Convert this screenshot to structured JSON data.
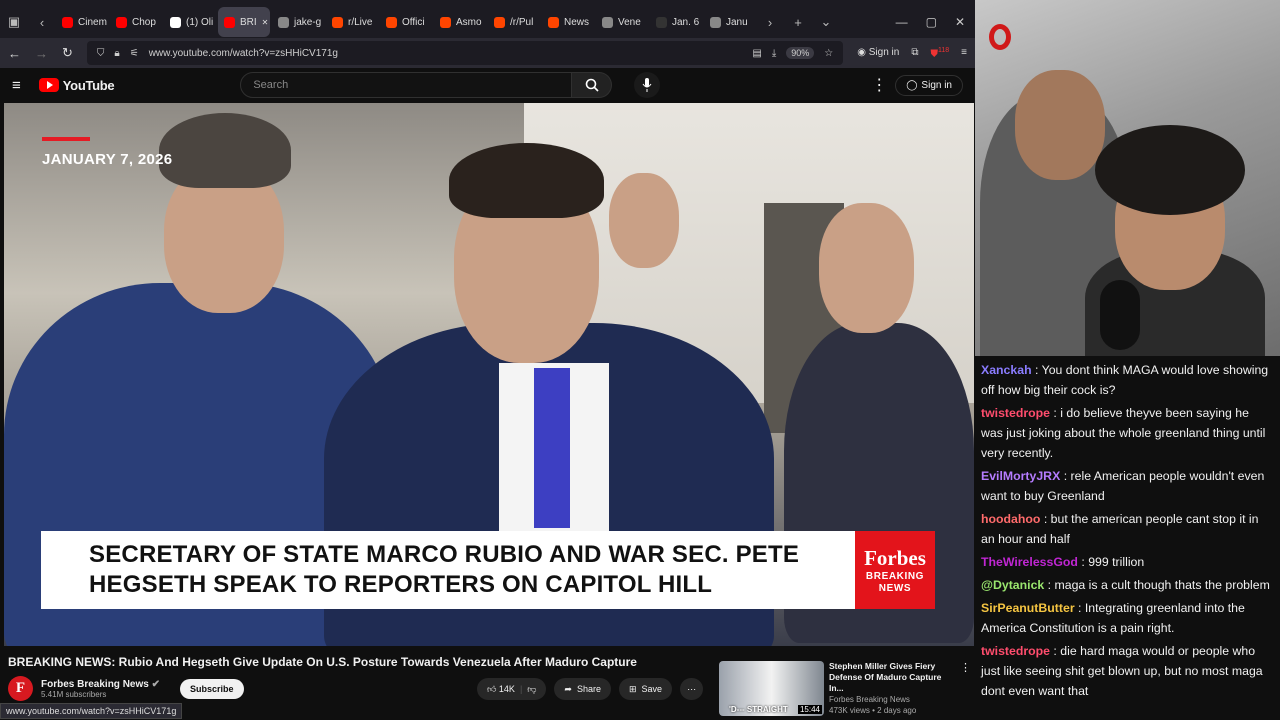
{
  "browser": {
    "tabs": [
      {
        "label": "Cinem",
        "icon": "youtube-icon"
      },
      {
        "label": "Chop",
        "icon": "youtube-icon"
      },
      {
        "label": "(1) Oli",
        "icon": "x-icon"
      },
      {
        "label": "BRI",
        "icon": "youtube-icon",
        "active": true
      },
      {
        "label": "jake-g",
        "icon": "page-icon"
      },
      {
        "label": "r/Live",
        "icon": "reddit-icon"
      },
      {
        "label": "Offici",
        "icon": "reddit-icon"
      },
      {
        "label": "Asmo",
        "icon": "reddit-icon"
      },
      {
        "label": "/r/Pul",
        "icon": "reddit-icon"
      },
      {
        "label": "News",
        "icon": "reddit-icon"
      },
      {
        "label": "Vene",
        "icon": "page-icon"
      },
      {
        "label": "Jan. 6",
        "icon": "abc-icon"
      },
      {
        "label": "Janu",
        "icon": "page-icon"
      }
    ],
    "url": "www.youtube.com/watch?v=zsHHiCV171g",
    "zoom": "90%",
    "sign_in": "Sign in",
    "badge": "118",
    "status_url": "www.youtube.com/watch?v=zsHHiCV171g"
  },
  "youtube": {
    "logo_text": "YouTube",
    "search_placeholder": "Search",
    "sign_in": "Sign in"
  },
  "video": {
    "date": "JANUARY 7, 2026",
    "lower_third_line1": "SECRETARY OF STATE MARCO RUBIO AND WAR SEC. PETE",
    "lower_third_line2": "HEGSETH SPEAK TO REPORTERS ON CAPITOL HILL",
    "forbes_logo": "Forbes",
    "forbes_tag1": "BREAKING",
    "forbes_tag2": "NEWS",
    "title": "BREAKING NEWS: Rubio And Hegseth Give Update On U.S. Posture Towards Venezuela After Maduro Capture",
    "channel_name": "Forbes Breaking News",
    "subscribers": "5.41M subscribers",
    "subscribe": "Subscribe",
    "likes": "14K",
    "share": "Share",
    "save": "Save"
  },
  "recommendation": {
    "title": "Stephen Miller Gives Fiery Defense Of Maduro Capture In...",
    "channel": "Forbes Breaking News",
    "meta": "473K views • 2 days ago",
    "duration": "15:44",
    "thumb_caption": "'D--- STRAIGHT"
  },
  "chat": [
    {
      "user": "Xanckah",
      "color": "#8a7cff",
      "text": "You dont think MAGA would love showing off how big their cock is?"
    },
    {
      "user": "twistedrope",
      "color": "#ff4d6d",
      "text": "i do believe theyve been saying he was just joking about the whole greenland thing until very recently."
    },
    {
      "user": "EvilMortyJRX",
      "color": "#b57cff",
      "text": "rele American people wouldn't even want to buy Greenland"
    },
    {
      "user": "hoodahoo",
      "color": "#ff6b6b",
      "text": "but the american people cant stop it in an hour and half"
    },
    {
      "user": "TheWirelessGod",
      "color": "#c026d3",
      "text": "999 trillion"
    },
    {
      "user": "@Dytanick",
      "color": "#9ae66e",
      "text": "maga is a cult though thats the problem"
    },
    {
      "user": "SirPeanutButter",
      "color": "#f5c542",
      "text": "Integrating greenland into the America Constitution is a pain right."
    },
    {
      "user": "twistedrope",
      "color": "#ff4d6d",
      "text": "die hard maga would or people who just like seeing shit get blown up, but no most maga dont even want that"
    }
  ]
}
